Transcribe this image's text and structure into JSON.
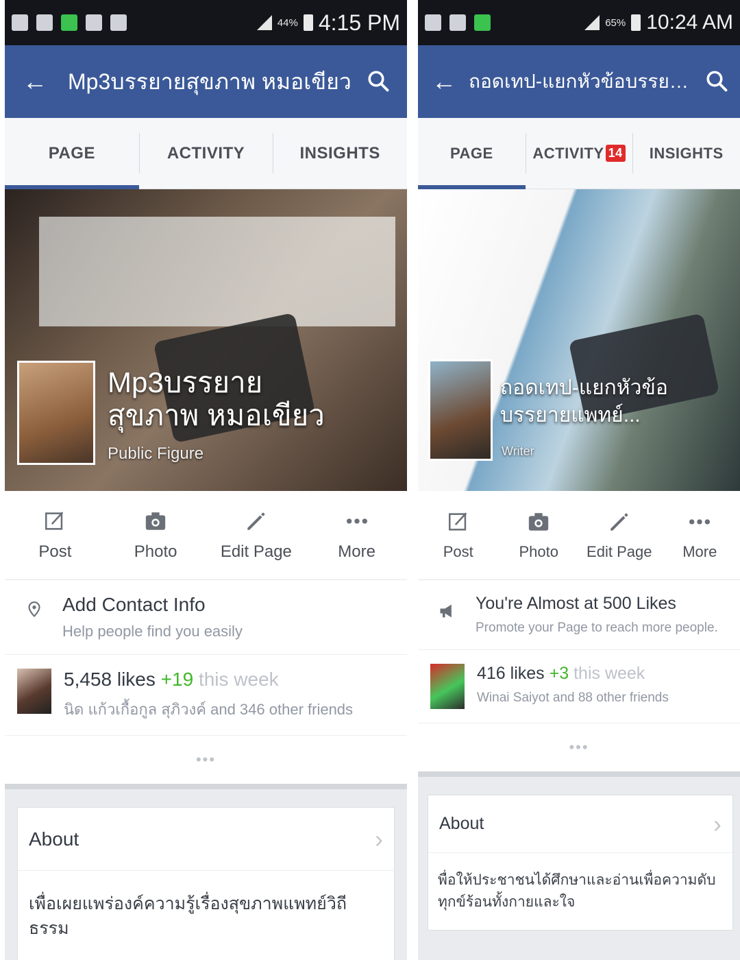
{
  "left": {
    "status": {
      "battery": "44%",
      "time": "4:15 PM"
    },
    "header": {
      "title": "Mp3บรรยายสุขภาพ หมอเขียว"
    },
    "tabs": [
      {
        "label": "PAGE"
      },
      {
        "label": "ACTIVITY"
      },
      {
        "label": "INSIGHTS"
      }
    ],
    "cover": {
      "page_name": "Mp3บรรยายสุขภาพ หมอเขียว",
      "category": "Public Figure"
    },
    "actions": [
      "Post",
      "Photo",
      "Edit Page",
      "More"
    ],
    "contact": {
      "title": "Add Contact Info",
      "subtitle": "Help people find you easily"
    },
    "likes": {
      "count": "5,458 likes",
      "delta": "+19",
      "period": "this week",
      "friends": "นิด แก้วเกื้อกูล สุภิวงค์ and 346 other friends"
    },
    "dots": "•••",
    "about": {
      "title": "About",
      "text": "เพื่อเผยแพร่องค์ความรู้เรื่องสุขภาพแพทย์วิถีธรรม"
    }
  },
  "right": {
    "status": {
      "battery": "65%",
      "time": "10:24 AM"
    },
    "header": {
      "title": "ถอดเทป-แยกหัวข้อบรรยายแพ..."
    },
    "tabs": [
      {
        "label": "PAGE"
      },
      {
        "label": "ACTIVITY",
        "badge": "14"
      },
      {
        "label": "INSIGHTS"
      }
    ],
    "cover": {
      "page_name": "ถอดเทป-แยกหัวข้อบรรยายแพทย์...",
      "category": "Writer"
    },
    "actions": [
      "Post",
      "Photo",
      "Edit Page",
      "More"
    ],
    "promo": {
      "title": "You're Almost at 500 Likes",
      "subtitle": "Promote your Page to reach more people."
    },
    "likes": {
      "count": "416 likes",
      "delta": "+3",
      "period": "this week",
      "friends": "Winai Saiyot and 88 other friends"
    },
    "dots": "•••",
    "about": {
      "title": "About",
      "text": "พื่อให้ประชาชนได้ศึกษาและอ่านเพื่อความดับทุกข์ร้อนทั้งกายและใจ"
    }
  }
}
